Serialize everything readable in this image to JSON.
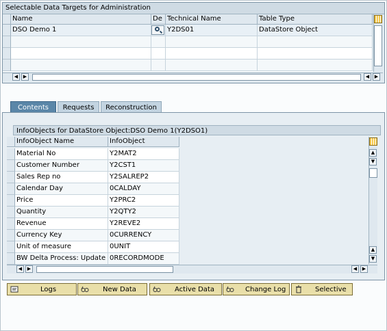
{
  "top_panel": {
    "title": "Selectable Data Targets for Administration",
    "columns": [
      "Name",
      "De",
      "Technical Name",
      "Table Type"
    ],
    "rows": [
      {
        "name": "DSO Demo 1",
        "technical_name": "Y2DS01",
        "table_type": "DataStore Object"
      }
    ]
  },
  "tabs": [
    "Contents",
    "Requests",
    "Reconstruction"
  ],
  "infoobjects": {
    "title": "InfoObjects for DataStore Object:DSO Demo 1(Y2DSO1)",
    "columns": [
      "InfoObject Name",
      "InfoObject"
    ],
    "rows": [
      {
        "name": "Material No",
        "id": "Y2MAT2"
      },
      {
        "name": "Customer Number",
        "id": "Y2CST1"
      },
      {
        "name": "Sales Rep no",
        "id": "Y2SALREP2"
      },
      {
        "name": "Calendar Day",
        "id": "0CALDAY"
      },
      {
        "name": "Price",
        "id": "Y2PRC2"
      },
      {
        "name": "Quantity",
        "id": "Y2QTY2"
      },
      {
        "name": "Revenue",
        "id": "Y2REVE2"
      },
      {
        "name": "Currency Key",
        "id": "0CURRENCY"
      },
      {
        "name": "Unit of measure",
        "id": "0UNIT"
      },
      {
        "name": "BW Delta Process: Update Mo",
        "id": "0RECORDMODE"
      }
    ]
  },
  "buttons": {
    "logs": "Logs",
    "new_data": "New Data",
    "active_data": "Active Data",
    "change_log": "Change Log",
    "selective": "Selective"
  }
}
